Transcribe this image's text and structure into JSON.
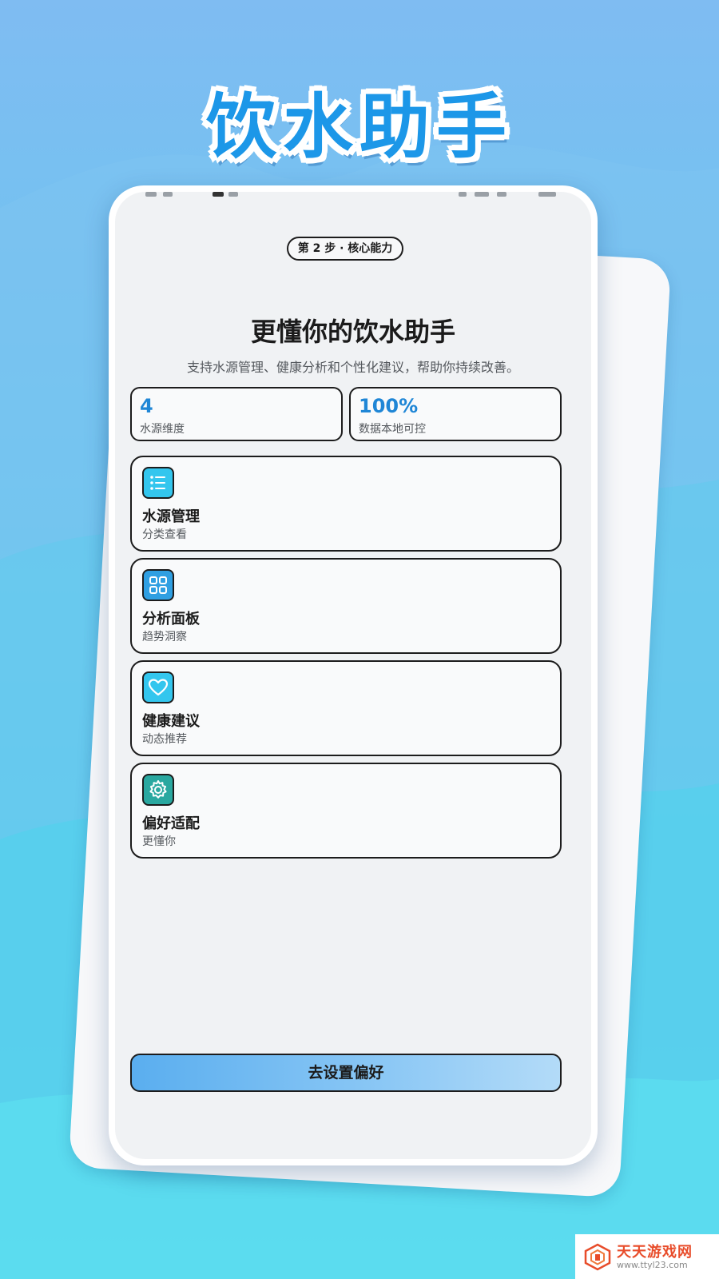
{
  "promo": {
    "title": "饮水助手"
  },
  "app": {
    "step_label": "第 2 步 · 核心能力",
    "headline": "更懂你的饮水助手",
    "subline": "支持水源管理、健康分析和个性化建议，帮助你持续改善。",
    "stats": [
      {
        "value": "4",
        "label": "水源维度"
      },
      {
        "value": "100%",
        "label": "数据本地可控"
      }
    ],
    "features": [
      {
        "title": "水源管理",
        "subtitle": "分类查看",
        "icon": "list-icon"
      },
      {
        "title": "分析面板",
        "subtitle": "趋势洞察",
        "icon": "grid-icon"
      },
      {
        "title": "健康建议",
        "subtitle": "动态推荐",
        "icon": "heart-icon"
      },
      {
        "title": "偏好适配",
        "subtitle": "更懂你",
        "icon": "gear-icon"
      }
    ],
    "cta_label": "去设置偏好"
  },
  "watermark": {
    "name": "天天游戏网",
    "url": "www.ttyl23.com"
  },
  "colors": {
    "accent": "#1f86d6",
    "promo_title": "#1c97e8",
    "icon_cyan": "#33c6ee",
    "icon_blue": "#2f9fe2",
    "icon_teal": "#2aa8a0",
    "watermark_red": "#e84c2a"
  }
}
